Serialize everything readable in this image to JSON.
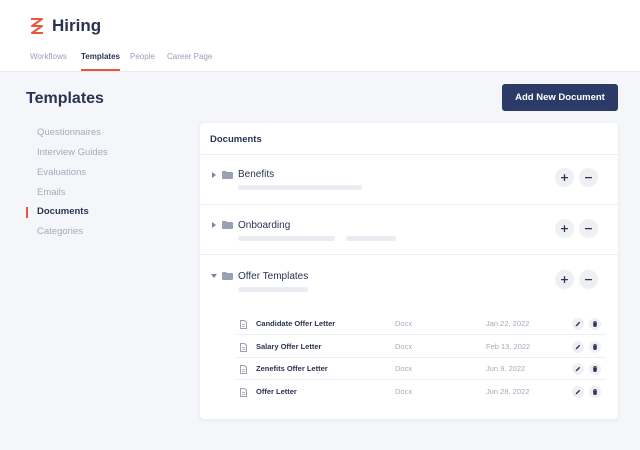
{
  "app": {
    "title": "Hiring",
    "accent_color": "#e8573d",
    "primary_color": "#2c3a68"
  },
  "tabs": [
    {
      "label": "Workflows",
      "active": false
    },
    {
      "label": "Templates",
      "active": true
    },
    {
      "label": "People",
      "active": false
    },
    {
      "label": "Career Page",
      "active": false
    }
  ],
  "page": {
    "title": "Templates",
    "add_button_label": "Add New Document"
  },
  "sidebar": {
    "items": [
      {
        "label": "Questionnaires",
        "active": false
      },
      {
        "label": "Interview Guides",
        "active": false
      },
      {
        "label": "Evaluations",
        "active": false
      },
      {
        "label": "Emails",
        "active": false
      },
      {
        "label": "Documents",
        "active": true
      },
      {
        "label": "Categories",
        "active": false
      }
    ]
  },
  "panel": {
    "title": "Documents",
    "folders": [
      {
        "name": "Benefits",
        "expanded": false,
        "add_icon": "plus-icon",
        "remove_icon": "minus-icon"
      },
      {
        "name": "Onboarding",
        "expanded": false,
        "add_icon": "plus-icon",
        "remove_icon": "minus-icon"
      },
      {
        "name": "Offer Templates",
        "expanded": true,
        "add_icon": "plus-icon",
        "remove_icon": "minus-icon",
        "documents": [
          {
            "name": "Candidate Offer Letter",
            "type": "Docx",
            "date": "Jan 22, 2022"
          },
          {
            "name": "Salary Offer Letter",
            "type": "Docx",
            "date": "Feb 13, 2022"
          },
          {
            "name": "Zenefits Offer Letter",
            "type": "Docx",
            "date": "Jun 9, 2022"
          },
          {
            "name": "Offer Letter",
            "type": "Docx",
            "date": "Jun 28, 2022"
          }
        ]
      }
    ]
  }
}
